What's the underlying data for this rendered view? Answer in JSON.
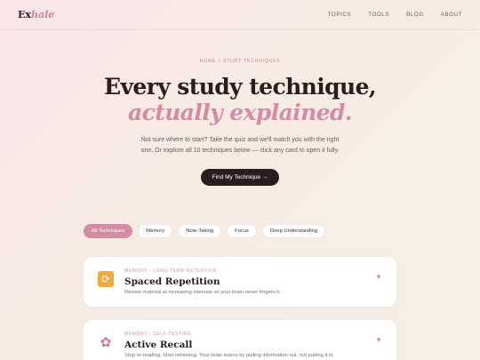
{
  "nav": {
    "logo_main": "Ex",
    "logo_accent": "hale",
    "links": [
      "TOPICS",
      "TOOLS",
      "BLOG",
      "ABOUT"
    ]
  },
  "hero": {
    "breadcrumb": "HOME > STUDY TECHNIQUES",
    "title_line1": "Every study technique,",
    "title_line2": "actually explained.",
    "subtitle_line1": "Not sure where to start? Take the quiz and we'll match you with the right",
    "subtitle_line2": "one. Or explore all 10 techniques below — click any card to open it fully.",
    "cta_label": "Find My Technique →"
  },
  "filters": [
    {
      "label": "All Techniques",
      "active": true
    },
    {
      "label": "Memory",
      "active": false
    },
    {
      "label": "Note-Taking",
      "active": false
    },
    {
      "label": "Focus",
      "active": false
    },
    {
      "label": "Deep Understanding",
      "active": false
    }
  ],
  "cards": [
    {
      "icon": "refresh-icon",
      "category": "MEMORY · LONG-TERM RETENTION",
      "title": "Spaced Repetition",
      "description": "Review material at increasing intervals so your brain never forgets it."
    },
    {
      "icon": "brain-icon",
      "category": "MEMORY · SELF-TESTING",
      "title": "Active Recall",
      "description": "Stop re-reading. Start retrieving. Your brain learns by pulling information out, not putting it in."
    }
  ],
  "colors": {
    "accent": "#d48ba4",
    "dark": "#2b1d1f"
  }
}
